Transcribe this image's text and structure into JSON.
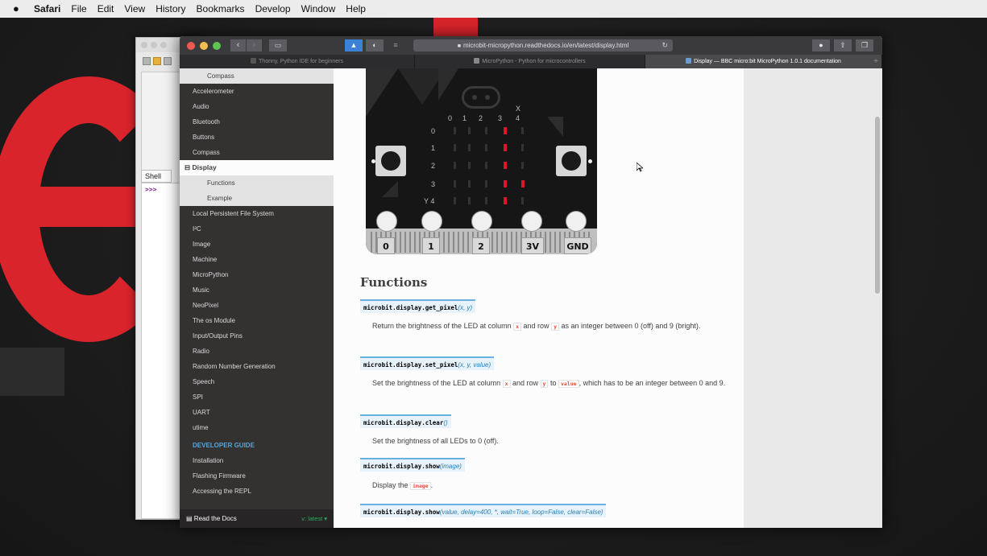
{
  "menubar": {
    "app": "Safari",
    "items": [
      "File",
      "Edit",
      "View",
      "History",
      "Bookmarks",
      "Develop",
      "Window",
      "Help"
    ]
  },
  "thonny": {
    "shell_tab": "Shell",
    "prompt": ">>>"
  },
  "safari": {
    "url": "microbit-micropython.readthedocs.io/en/latest/display.html",
    "tabs": [
      {
        "label": "Thonny, Python IDE for beginners",
        "active": false
      },
      {
        "label": "MicroPython - Python for microcontrollers",
        "active": false
      },
      {
        "label": "Display — BBC micro:bit MicroPython 1.0.1 documentation",
        "active": true
      }
    ],
    "colors": {
      "toolbar": "#3a3a3c",
      "sidebar": "#343131",
      "accent": "#2980b9"
    }
  },
  "sidebar": {
    "top_sub": "Compass",
    "items": [
      "Accelerometer",
      "Audio",
      "Bluetooth",
      "Buttons",
      "Compass"
    ],
    "current": "Display",
    "current_subs": [
      "Functions",
      "Example"
    ],
    "items2": [
      "Local Persistent File System",
      "I²C",
      "Image",
      "Machine",
      "MicroPython",
      "Music",
      "NeoPixel",
      "The os Module",
      "Input/Output Pins",
      "Radio",
      "Random Number Generation",
      "Speech",
      "SPI",
      "UART",
      "utime"
    ],
    "caption": "DEVELOPER GUIDE",
    "items3": [
      "Installation",
      "Flashing Firmware",
      "Accessing the REPL"
    ],
    "footer_label": "Read the Docs",
    "footer_version": "v: latest ▾"
  },
  "microbit": {
    "col_labels": [
      "0",
      "1",
      "2",
      "3",
      "4"
    ],
    "row_labels": [
      "0",
      "1",
      "2",
      "3",
      "Y 4"
    ],
    "x_label": "X",
    "pins": [
      "0",
      "1",
      "2",
      "3V",
      "GND"
    ]
  },
  "article": {
    "section_title": "Functions",
    "functions": [
      {
        "name": "microbit.display.get_pixel",
        "args": "(x, y)",
        "desc": [
          "Return the brightness of the LED at column ",
          "x",
          " and row ",
          "y",
          " as an integer between 0 (off) and 9 (bright)."
        ]
      },
      {
        "name": "microbit.display.set_pixel",
        "args": "(x, y, value)",
        "desc": [
          "Set the brightness of the LED at column ",
          "x",
          " and row ",
          "y",
          " to ",
          "value",
          ", which has to be an integer between 0 and 9."
        ]
      },
      {
        "name": "microbit.display.clear",
        "args": "()",
        "desc": [
          "Set the brightness of all LEDs to 0 (off)."
        ]
      },
      {
        "name": "microbit.display.show",
        "args": "(image)",
        "desc": [
          "Display the ",
          "image",
          "."
        ]
      },
      {
        "name": "microbit.display.show",
        "args": "(value, delay=400, *, wait=True, loop=False, clear=False)",
        "desc": []
      }
    ]
  }
}
